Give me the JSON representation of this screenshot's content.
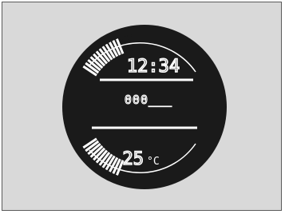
{
  "display": {
    "time": "12:34",
    "odometer": "000___",
    "temperature": "25",
    "temperature_unit": "°C",
    "bar_gauge_top_level": 0.75,
    "bar_gauge_bottom_level": 0.75
  },
  "colors": {
    "panel_background": "#d9d9d9",
    "display_face": "#1a1a1a",
    "segment_lit": "#ffffff",
    "frame_border": "#5a5a5a"
  }
}
